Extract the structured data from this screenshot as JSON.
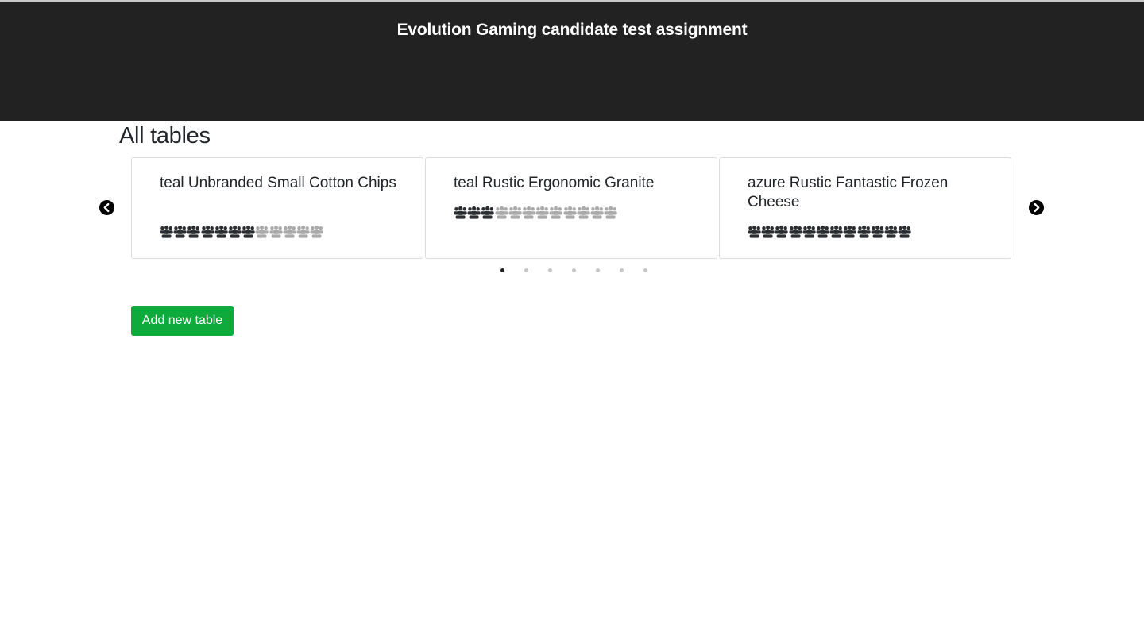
{
  "header": {
    "title": "Evolution Gaming candidate test assignment"
  },
  "main": {
    "title": "All tables",
    "add_button_label": "Add new table"
  },
  "carousel": {
    "prev_icon": "chevron-left-circle-icon",
    "next_icon": "chevron-right-circle-icon",
    "page_count": 7,
    "active_page": 1,
    "cards": [
      {
        "name": "teal Unbranded Small Cotton Chips",
        "seats_total": 12,
        "seats_occupied": 7
      },
      {
        "name": "teal Rustic Ergonomic Granite",
        "seats_total": 12,
        "seats_occupied": 3
      },
      {
        "name": "azure Rustic Fantastic Frozen Cheese",
        "seats_total": 12,
        "seats_occupied": 12
      }
    ]
  },
  "colors": {
    "header_bg": "#222222",
    "seat_occupied": "#2a2d31",
    "seat_free": "#aaaaaa",
    "button_bg": "#0eaa3c"
  }
}
